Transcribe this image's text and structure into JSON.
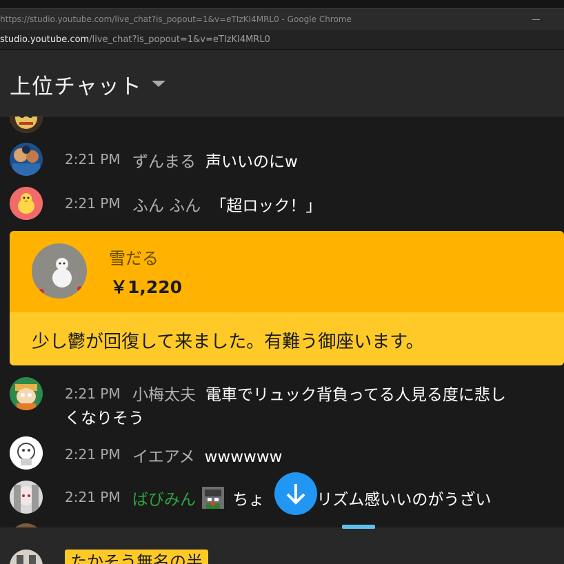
{
  "window": {
    "title": "https://studio.youtube.com/live_chat?is_popout=1&v=eTIzKI4MRL0 - Google Chrome"
  },
  "address": {
    "host": "studio.youtube.com",
    "path": "/live_chat?is_popout=1&v=eTIzKI4MRL0"
  },
  "header": {
    "title": "上位チャット"
  },
  "messages": [
    {
      "time": "2:21 PM",
      "author": "ずんまる",
      "text": "声いいのにw"
    },
    {
      "time": "2:21 PM",
      "author": "ふん ふん",
      "text": "「超ロック！」"
    },
    {
      "time": "2:21 PM",
      "author": "小梅太夫",
      "text": "電車でリュック背負ってる人見る度に悲し",
      "text2": "くなりそう"
    },
    {
      "time": "2:21 PM",
      "author": "イエアメ",
      "text": "wwwwww"
    },
    {
      "time": "2:21 PM",
      "author": "ばびみん",
      "text": "ちょ",
      "text_after": "リズム感いいのがうざい"
    }
  ],
  "superchat": {
    "author": "雪だる",
    "amount": "￥1,220",
    "message": "少し鬱が回復して来ました。有難う御座います。"
  },
  "footer": {
    "ticker_text": "たかそう無名の半"
  },
  "colors": {
    "superchat_header": "#ffb300",
    "superchat_body": "#ffca28",
    "member_author": "#2ba640",
    "scroll_button": "#2196f3"
  }
}
